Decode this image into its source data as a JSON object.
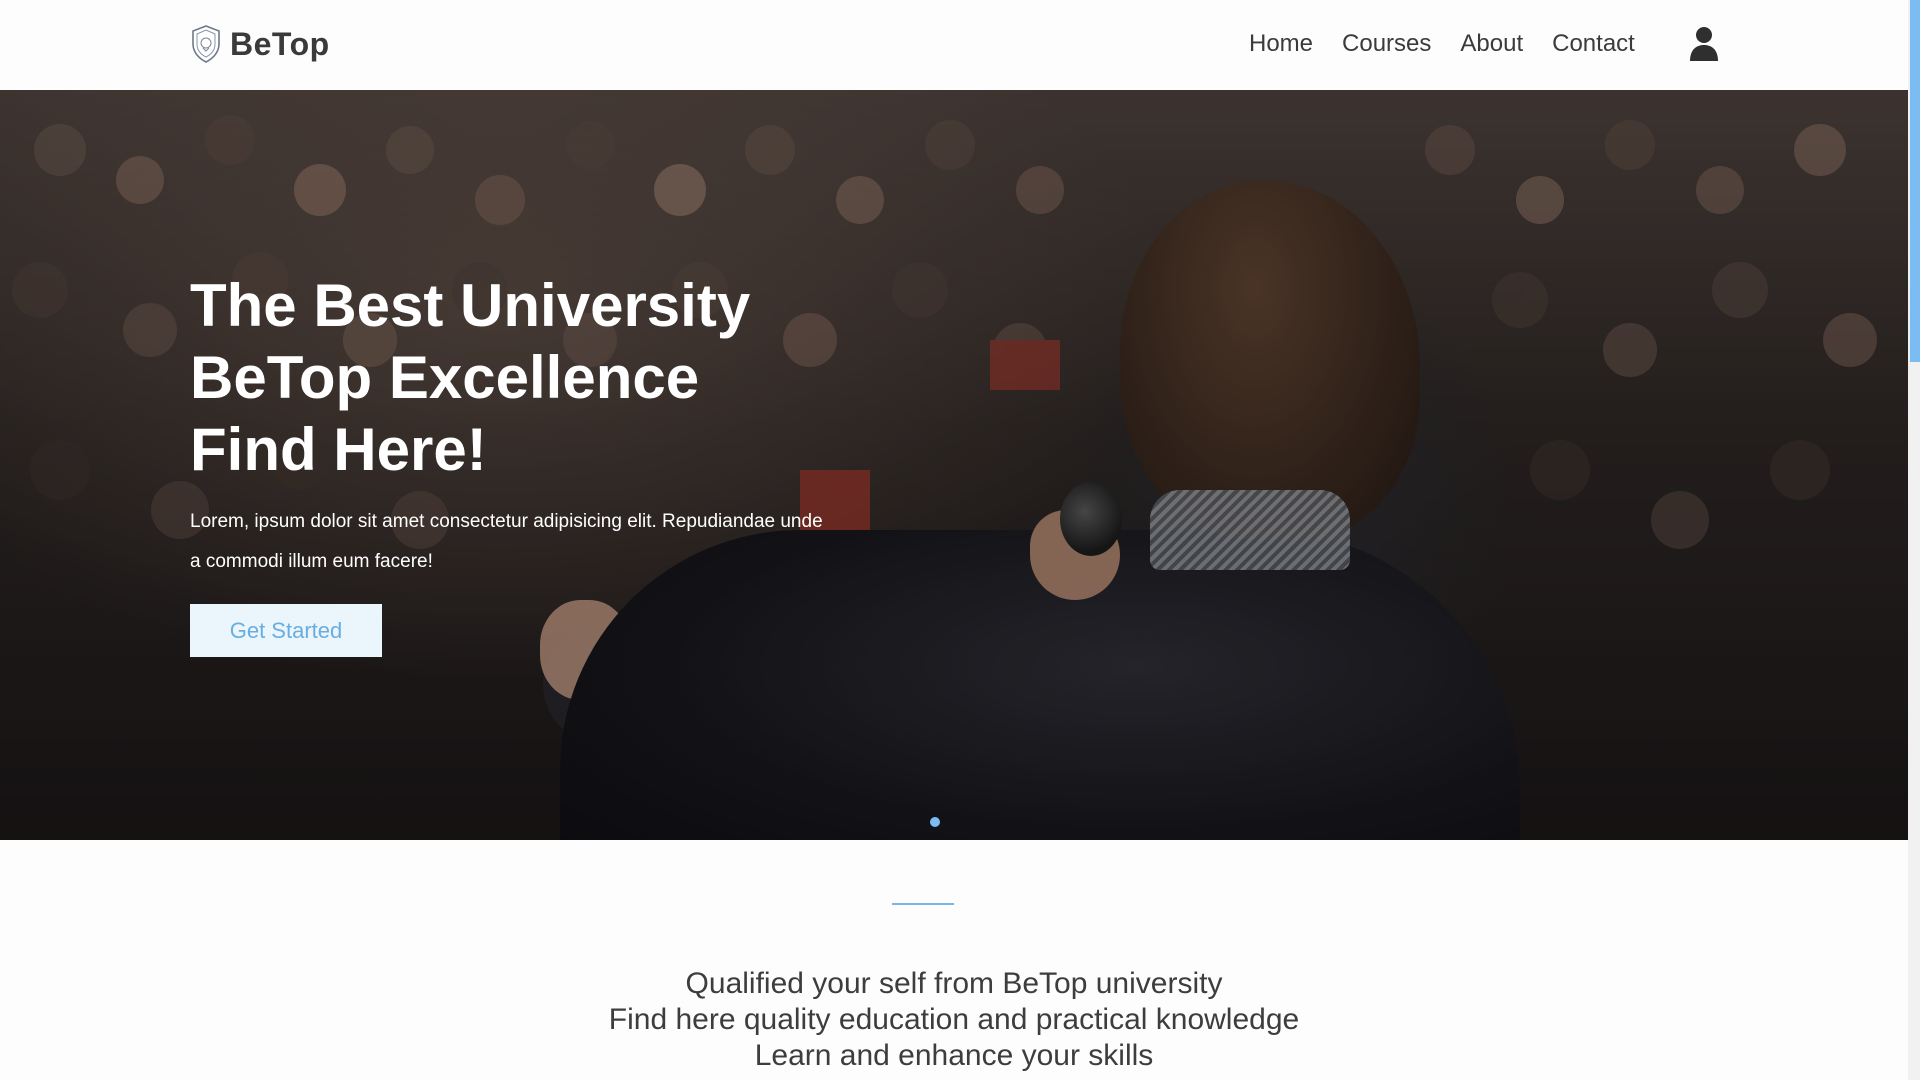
{
  "navbar": {
    "brand": "BeTop",
    "links": [
      "Home",
      "Courses",
      "About",
      "Contact"
    ]
  },
  "hero": {
    "title_lines": [
      "The Best University",
      "BeTop Excellence",
      "Find Here!"
    ],
    "text": "Lorem, ipsum dolor sit amet consectetur adipisicing elit. Repudiandae unde a commodi illum eum facere!",
    "button_label": "Get Started"
  },
  "intro": {
    "lines": [
      "Qualified your self from BeTop university",
      "Find here quality education and practical knowledge",
      "Learn and enhance your skills"
    ]
  },
  "colors": {
    "accent": "#7bbdf2",
    "button_bg": "#eaf5fc",
    "button_text": "#6aaee0",
    "text_dark": "#3b3b3b"
  },
  "icons": [
    "shield-logo-icon",
    "user-icon"
  ]
}
